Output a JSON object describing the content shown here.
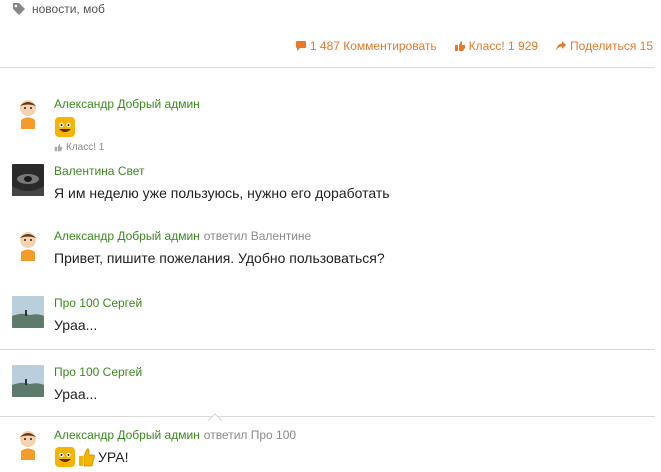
{
  "tags": {
    "text": "новости, моб",
    "icon": "tag-icon"
  },
  "actions": {
    "comment": "1 487 Комментировать",
    "klass": "Класс! 1 929",
    "share": "Поделиться 15"
  },
  "colors": {
    "accent": "#e8792a",
    "author": "#3c8a1f",
    "muted": "#8a8a8a"
  },
  "comments": [
    {
      "author": "Александр Добрый админ",
      "reply": "",
      "text": "",
      "emoji": [
        "smile-icon"
      ],
      "like": "Класс! 1",
      "avatar": "cartoon-avatar"
    },
    {
      "author": "Валентина Свет",
      "reply": "",
      "text": "Я им неделю уже пользуюсь, нужно его доработать",
      "avatar": "photo-avatar"
    },
    {
      "author": "Александр Добрый админ",
      "reply": "ответил Валентине",
      "text": "Привет, пишите пожелания. Удобно пользоваться?",
      "avatar": "cartoon-avatar"
    },
    {
      "author": "Про 100 Сергей",
      "reply": "",
      "text": "Ураа...",
      "avatar": "landscape-avatar"
    },
    {
      "author": "Про 100 Сергей",
      "reply": "",
      "text": "Ураа...",
      "avatar": "landscape-avatar"
    },
    {
      "author": "Александр Добрый админ",
      "reply": "ответил Про 100",
      "text": "УРА!",
      "emoji": [
        "smile-icon",
        "thumbs-up-icon"
      ],
      "avatar": "cartoon-avatar"
    }
  ]
}
